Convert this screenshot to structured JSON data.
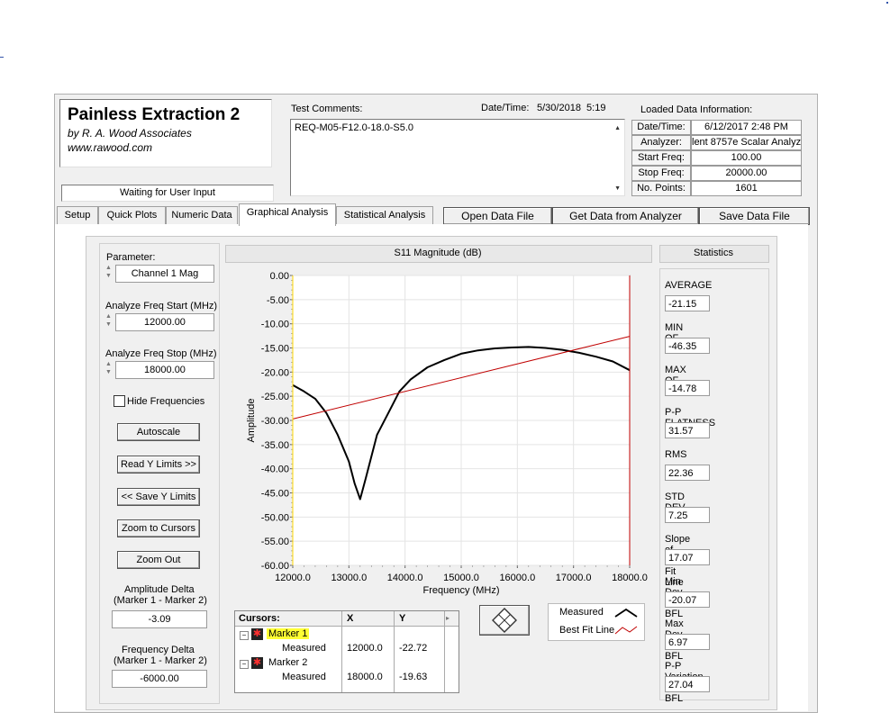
{
  "app": {
    "title": "Painless Extraction 2",
    "author": "by R. A. Wood Associates",
    "website": "www.rawood.com",
    "status": "Waiting for User Input"
  },
  "comments": {
    "label": "Test Comments:",
    "text": "REQ-M05-F12.0-18.0-S5.0",
    "datetime_label": "Date/Time:",
    "datetime_value": "5/30/2018  5:19"
  },
  "loaded_info": {
    "title": "Loaded Data Information:",
    "rows": [
      {
        "key": "Date/Time:",
        "value": "6/12/2017 2:48 PM"
      },
      {
        "key": "Analyzer:",
        "value": "lent 8757e Scalar Analyz"
      },
      {
        "key": "Start Freq:",
        "value": "100.00"
      },
      {
        "key": "Stop Freq:",
        "value": "20000.00"
      },
      {
        "key": "No. Points:",
        "value": "1601"
      }
    ]
  },
  "tabs": [
    "Setup",
    "Quick Plots",
    "Numeric Data",
    "Graphical Analysis",
    "Statistical Analysis"
  ],
  "toolbar": {
    "open": "Open Data File",
    "get": "Get Data from Analyzer",
    "save": "Save Data File"
  },
  "controls": {
    "parameter_label": "Parameter:",
    "parameter_value": "Channel 1 Mag",
    "start_label": "Analyze Freq Start (MHz)",
    "start_value": "12000.00",
    "stop_label": "Analyze Freq Stop (MHz)",
    "stop_value": "18000.00",
    "hide_freq": "Hide Frequencies",
    "autoscale": "Autoscale",
    "read_y": "Read Y Limits >>",
    "save_y": "<< Save Y Limits",
    "zoom_cursors": "Zoom to Cursors",
    "zoom_out": "Zoom Out",
    "amp_delta_label1": "Amplitude Delta",
    "amp_delta_label2": "(Marker 1 - Marker 2)",
    "amp_delta_value": "-3.09",
    "freq_delta_label1": "Frequency Delta",
    "freq_delta_label2": "(Marker 1 - Marker 2)",
    "freq_delta_value": "-6000.00"
  },
  "cursors": {
    "title": "Cursors:",
    "col_x": "X",
    "col_y": "Y",
    "rows": [
      {
        "name": "Marker 1",
        "sub": "Measured",
        "x": "12000.0",
        "y": "-22.72"
      },
      {
        "name": "Marker 2",
        "sub": "Measured",
        "x": "18000.0",
        "y": "-19.63"
      }
    ]
  },
  "legend": {
    "measured": "Measured",
    "bestfit": "Best Fit Line"
  },
  "statistics": {
    "title": "Statistics",
    "items": [
      {
        "label": "AVERAGE",
        "value": "-21.15"
      },
      {
        "label": "MIN OF DATA",
        "value": "-46.35"
      },
      {
        "label": "MAX OF DATA",
        "value": "-14.78"
      },
      {
        "label": "P-P FLATNESS",
        "value": "31.57"
      },
      {
        "label": "RMS",
        "value": "22.36"
      },
      {
        "label": "STD DEV",
        "value": "7.25"
      },
      {
        "label": "Slope of Best Fit Line",
        "value": "17.07"
      },
      {
        "label": "Min Dev from BFL",
        "value": "-20.07"
      },
      {
        "label": "Max Dev from BFL",
        "value": "6.97"
      },
      {
        "label": "P-P Variation from BFL",
        "value": "27.04"
      }
    ]
  },
  "colors": {
    "measured": "#000000",
    "bestfit": "#c00000",
    "marker_highlight": "#ffff33"
  },
  "chart_data": {
    "type": "line",
    "title": "S11 Magnitude (dB)",
    "xlabel": "Frequency (MHz)",
    "ylabel": "Amplitude",
    "xlim": [
      12000,
      18000
    ],
    "ylim": [
      -60,
      0
    ],
    "xticks": [
      "12000.0",
      "13000.0",
      "14000.0",
      "15000.0",
      "16000.0",
      "17000.0",
      "18000.0"
    ],
    "yticks": [
      "0.00",
      "-5.00",
      "-10.00",
      "-15.00",
      "-20.00",
      "-25.00",
      "-30.00",
      "-35.00",
      "-40.00",
      "-45.00",
      "-50.00",
      "-55.00",
      "-60.00"
    ],
    "grid": true,
    "series": [
      {
        "name": "Measured",
        "x": [
          12000,
          12200,
          12400,
          12600,
          12800,
          13000,
          13100,
          13200,
          13300,
          13500,
          13700,
          13900,
          14100,
          14400,
          14700,
          15000,
          15300,
          15600,
          15900,
          16200,
          16500,
          16800,
          17100,
          17400,
          17700,
          18000
        ],
        "y": [
          -22.7,
          -24.0,
          -25.5,
          -28.5,
          -33.0,
          -38.5,
          -43.0,
          -46.3,
          -42.0,
          -33.0,
          -28.5,
          -24.0,
          -21.5,
          -19.0,
          -17.5,
          -16.2,
          -15.5,
          -15.1,
          -14.9,
          -14.8,
          -15.0,
          -15.4,
          -16.0,
          -16.8,
          -17.8,
          -19.6
        ]
      },
      {
        "name": "Best Fit Line",
        "x": [
          12000,
          18000
        ],
        "y": [
          -29.7,
          -12.6
        ]
      }
    ],
    "markers": [
      {
        "x": 12000
      },
      {
        "x": 18000
      }
    ]
  }
}
